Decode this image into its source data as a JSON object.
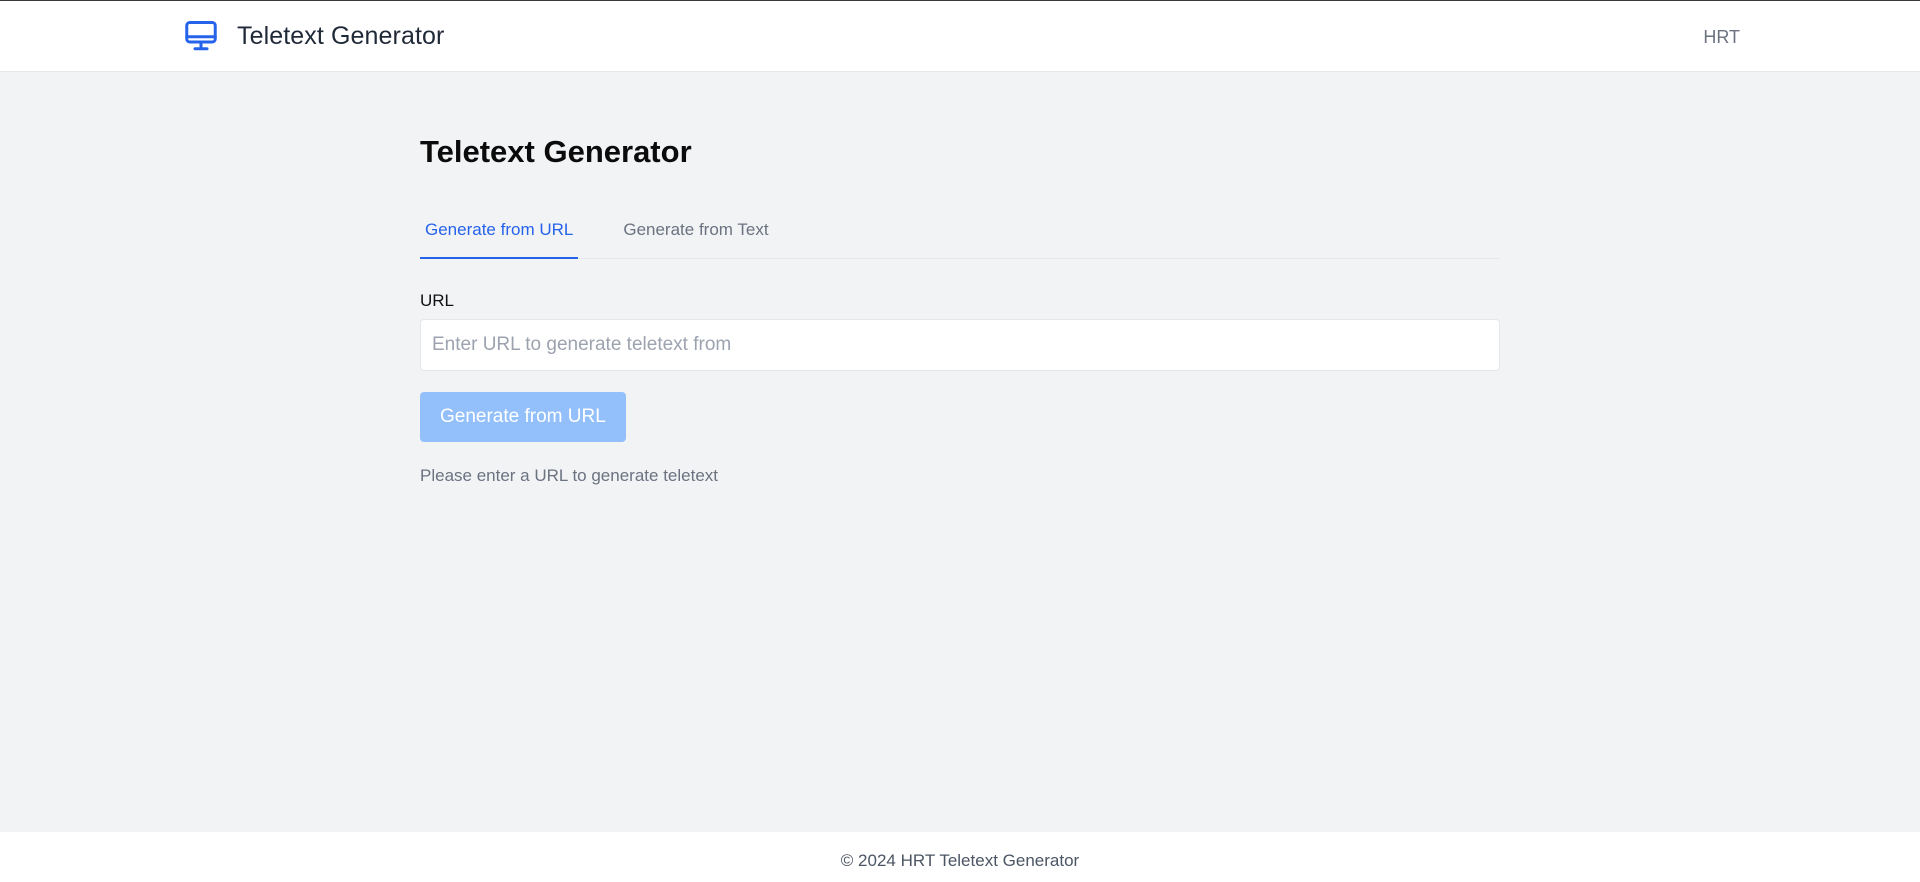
{
  "header": {
    "brand_title": "Teletext Generator",
    "brand_icon": "monitor-icon",
    "nav_link": "HRT"
  },
  "main": {
    "page_title": "Teletext Generator",
    "tabs": [
      {
        "label": "Generate from URL",
        "active": true
      },
      {
        "label": "Generate from Text",
        "active": false
      }
    ],
    "url_label": "URL",
    "url_value": "",
    "url_placeholder": "Enter URL to generate teletext from",
    "generate_button": "Generate from URL",
    "hint": "Please enter a URL to generate teletext"
  },
  "footer": {
    "copyright": "© 2024 HRT Teletext Generator"
  },
  "colors": {
    "accent": "#2563eb",
    "button_disabled": "#93c0fa",
    "background": "#f2f3f5"
  }
}
